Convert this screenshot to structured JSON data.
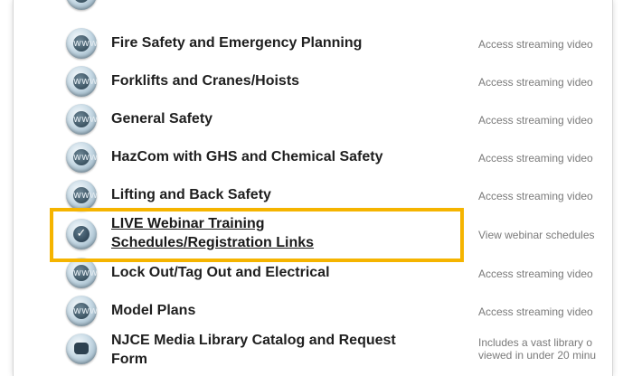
{
  "rows": [
    {
      "title": "Fire Safety and Emergency Planning",
      "desc": "Access streaming video",
      "icon": "web-icon"
    },
    {
      "title": "Forklifts and Cranes/Hoists",
      "desc": "Access streaming video",
      "icon": "web-icon"
    },
    {
      "title": "General Safety",
      "desc": "Access streaming video",
      "icon": "web-icon"
    },
    {
      "title": "HazCom with GHS and Chemical Safety",
      "desc": "Access streaming video",
      "icon": "web-icon"
    },
    {
      "title": "Lifting and Back Safety",
      "desc": "Access streaming video",
      "icon": "web-icon"
    },
    {
      "title_line1": "LIVE Webinar Training",
      "title_line2": "Schedules/Registration Links",
      "desc": "View webinar schedules",
      "icon": "check-icon"
    },
    {
      "title": "Lock Out/Tag Out and Electrical",
      "desc": "Access streaming video",
      "icon": "web-icon"
    },
    {
      "title": "Model Plans",
      "desc": "Access streaming video",
      "icon": "web-icon"
    },
    {
      "title_line1": "NJCE Media Library Catalog and Request",
      "title_line2": "Form",
      "desc_line1": "Includes a vast library o",
      "desc_line2": "viewed in under 20 minu",
      "icon": "camera-icon"
    }
  ],
  "icon_glyphs": {
    "web": "www",
    "check": "✓"
  },
  "colors": {
    "highlight": "#f5b400",
    "title": "#1f1f1f",
    "desc": "#7a7a7a"
  }
}
